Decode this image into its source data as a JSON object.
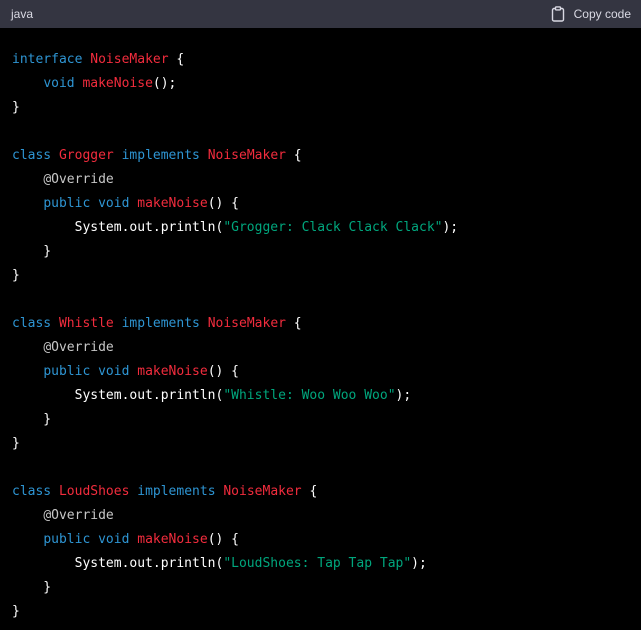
{
  "header": {
    "language": "java",
    "copy_label": "Copy code"
  },
  "colors": {
    "keyword": "#2e95d3",
    "class": "#f22c3d",
    "function": "#f22c3d",
    "string": "#00a67d",
    "annotation": "#c7c7c7",
    "plain": "#ffffff",
    "header_bg": "#343541",
    "code_bg": "#000000"
  },
  "code": {
    "lines": [
      [
        [
          "keyword",
          "interface"
        ],
        [
          "plain",
          " "
        ],
        [
          "class",
          "NoiseMaker"
        ],
        [
          "plain",
          " {"
        ]
      ],
      [
        [
          "plain",
          "    "
        ],
        [
          "keyword",
          "void"
        ],
        [
          "plain",
          " "
        ],
        [
          "func",
          "makeNoise"
        ],
        [
          "plain",
          "();"
        ]
      ],
      [
        [
          "plain",
          "}"
        ]
      ],
      [],
      [
        [
          "keyword",
          "class"
        ],
        [
          "plain",
          " "
        ],
        [
          "class",
          "Grogger"
        ],
        [
          "plain",
          " "
        ],
        [
          "keyword",
          "implements"
        ],
        [
          "plain",
          " "
        ],
        [
          "class",
          "NoiseMaker"
        ],
        [
          "plain",
          " {"
        ]
      ],
      [
        [
          "plain",
          "    "
        ],
        [
          "annot",
          "@Override"
        ]
      ],
      [
        [
          "plain",
          "    "
        ],
        [
          "keyword",
          "public"
        ],
        [
          "plain",
          " "
        ],
        [
          "keyword",
          "void"
        ],
        [
          "plain",
          " "
        ],
        [
          "func",
          "makeNoise"
        ],
        [
          "plain",
          "() {"
        ]
      ],
      [
        [
          "plain",
          "        System.out.println("
        ],
        [
          "string",
          "\"Grogger: Clack Clack Clack\""
        ],
        [
          "plain",
          ");"
        ]
      ],
      [
        [
          "plain",
          "    }"
        ]
      ],
      [
        [
          "plain",
          "}"
        ]
      ],
      [],
      [
        [
          "keyword",
          "class"
        ],
        [
          "plain",
          " "
        ],
        [
          "class",
          "Whistle"
        ],
        [
          "plain",
          " "
        ],
        [
          "keyword",
          "implements"
        ],
        [
          "plain",
          " "
        ],
        [
          "class",
          "NoiseMaker"
        ],
        [
          "plain",
          " {"
        ]
      ],
      [
        [
          "plain",
          "    "
        ],
        [
          "annot",
          "@Override"
        ]
      ],
      [
        [
          "plain",
          "    "
        ],
        [
          "keyword",
          "public"
        ],
        [
          "plain",
          " "
        ],
        [
          "keyword",
          "void"
        ],
        [
          "plain",
          " "
        ],
        [
          "func",
          "makeNoise"
        ],
        [
          "plain",
          "() {"
        ]
      ],
      [
        [
          "plain",
          "        System.out.println("
        ],
        [
          "string",
          "\"Whistle: Woo Woo Woo\""
        ],
        [
          "plain",
          ");"
        ]
      ],
      [
        [
          "plain",
          "    }"
        ]
      ],
      [
        [
          "plain",
          "}"
        ]
      ],
      [],
      [
        [
          "keyword",
          "class"
        ],
        [
          "plain",
          " "
        ],
        [
          "class",
          "LoudShoes"
        ],
        [
          "plain",
          " "
        ],
        [
          "keyword",
          "implements"
        ],
        [
          "plain",
          " "
        ],
        [
          "class",
          "NoiseMaker"
        ],
        [
          "plain",
          " {"
        ]
      ],
      [
        [
          "plain",
          "    "
        ],
        [
          "annot",
          "@Override"
        ]
      ],
      [
        [
          "plain",
          "    "
        ],
        [
          "keyword",
          "public"
        ],
        [
          "plain",
          " "
        ],
        [
          "keyword",
          "void"
        ],
        [
          "plain",
          " "
        ],
        [
          "func",
          "makeNoise"
        ],
        [
          "plain",
          "() {"
        ]
      ],
      [
        [
          "plain",
          "        System.out.println("
        ],
        [
          "string",
          "\"LoudShoes: Tap Tap Tap\""
        ],
        [
          "plain",
          ");"
        ]
      ],
      [
        [
          "plain",
          "    }"
        ]
      ],
      [
        [
          "plain",
          "}"
        ]
      ]
    ]
  }
}
